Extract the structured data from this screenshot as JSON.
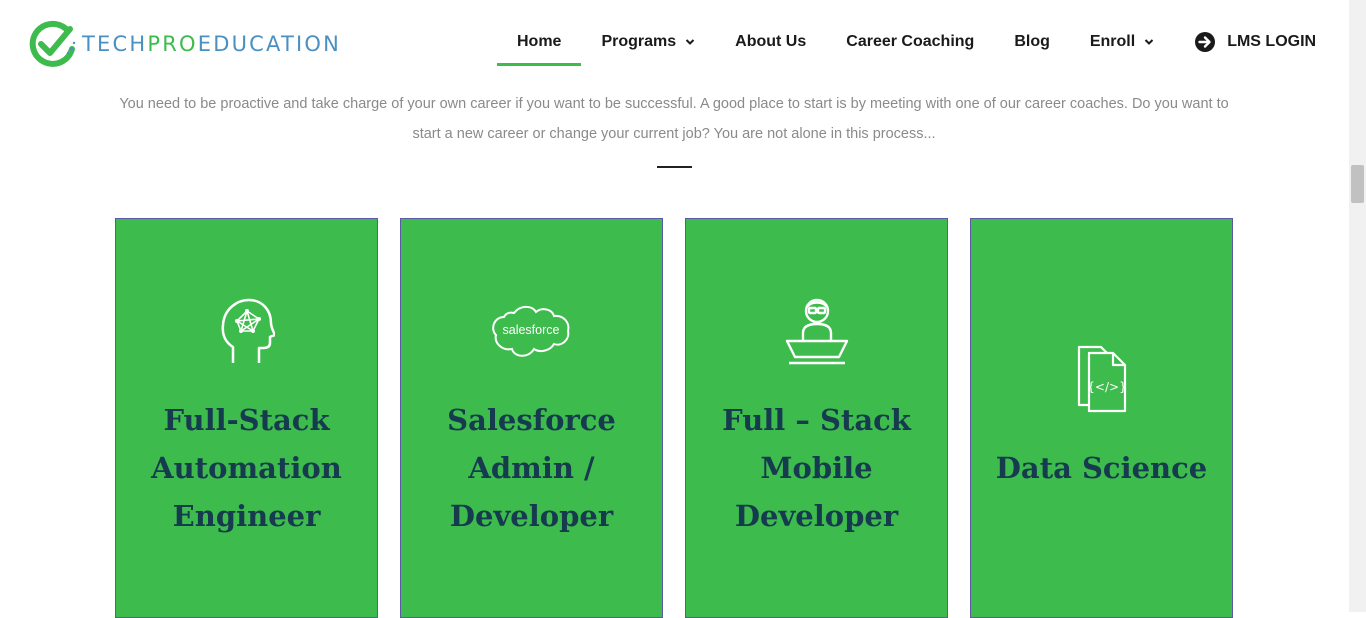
{
  "brand": {
    "name_part1": "TECH",
    "name_part2": "PRO",
    "name_part3": "EDUCATION",
    "primary_color": "#3dbb4d",
    "secondary_color": "#4a90c2"
  },
  "nav": {
    "items": [
      {
        "label": "Home",
        "active": true
      },
      {
        "label": "Programs",
        "has_dropdown": true
      },
      {
        "label": "About Us"
      },
      {
        "label": "Career Coaching"
      },
      {
        "label": "Blog"
      },
      {
        "label": "Enroll",
        "has_dropdown": true
      },
      {
        "label": "LMS LOGIN",
        "icon": "arrow-circle-right-icon"
      }
    ]
  },
  "intro": {
    "text": "You need to be proactive and take charge of your own career if you want to be successful. A good place to start is by meeting with one of our career coaches.  Do you want to start a new career or change your current job? You are not alone in this process..."
  },
  "cards": [
    {
      "title": "Full-Stack Automation Engineer",
      "lines": [
        "Full-",
        "Stack",
        "Automation",
        "Engineer"
      ],
      "icon": "brain-head-icon"
    },
    {
      "title": "Salesforce Admin / Developer",
      "icon": "salesforce-cloud-icon",
      "icon_text": "salesforce"
    },
    {
      "title": "Full – Stack Mobile Developer",
      "icon": "developer-laptop-icon"
    },
    {
      "title": "Data Science",
      "icon": "code-files-icon",
      "icon_text": "{</>}"
    }
  ],
  "colors": {
    "card_bg": "#3dbb4d",
    "card_title": "#163a4e",
    "intro_text": "#8a8a8a"
  }
}
